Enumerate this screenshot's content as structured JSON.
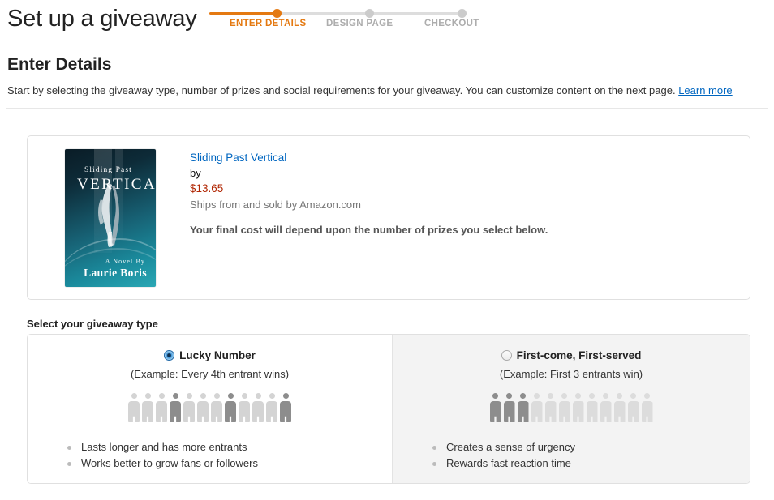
{
  "header": {
    "title": "Set up a giveaway",
    "steps": [
      {
        "label": "ENTER DETAILS",
        "state": "active"
      },
      {
        "label": "DESIGN PAGE",
        "state": "pending"
      },
      {
        "label": "CHECKOUT",
        "state": "pending"
      }
    ],
    "accent_color": "#e47911",
    "pending_color": "#adadad"
  },
  "section": {
    "title": "Enter Details",
    "intro_text": "Start by selecting the giveaway type, number of prizes and social requirements for your giveaway. You can customize content on the next page.",
    "learn_more": "Learn more",
    "link_color": "#0066c0"
  },
  "product": {
    "cover": {
      "title_line1": "Sliding Past",
      "title_line2": "VERTICAL",
      "author_prefix": "A Novel By",
      "author": "Laurie Boris"
    },
    "title": "Sliding Past Vertical",
    "by": "by",
    "price": "$13.65",
    "price_color": "#b12704",
    "shipping": "Ships from and sold by Amazon.com",
    "note": "Your final cost will depend upon the number of prizes you select below."
  },
  "giveaway_type": {
    "label": "Select your giveaway type",
    "options": [
      {
        "id": "lucky-number",
        "name": "Lucky Number",
        "selected": true,
        "example": "(Example: Every 4th entrant wins)",
        "people_total": 12,
        "people_highlighted": [
          4,
          8,
          12
        ],
        "bullets": [
          "Lasts longer and has more entrants",
          "Works better to grow fans or followers"
        ]
      },
      {
        "id": "first-come-first-served",
        "name": "First-come, First-served",
        "selected": false,
        "example": "(Example: First 3 entrants win)",
        "people_total": 12,
        "people_highlighted": [
          1,
          2,
          3
        ],
        "bullets": [
          "Creates a sense of urgency",
          "Rewards fast reaction time"
        ]
      }
    ]
  }
}
